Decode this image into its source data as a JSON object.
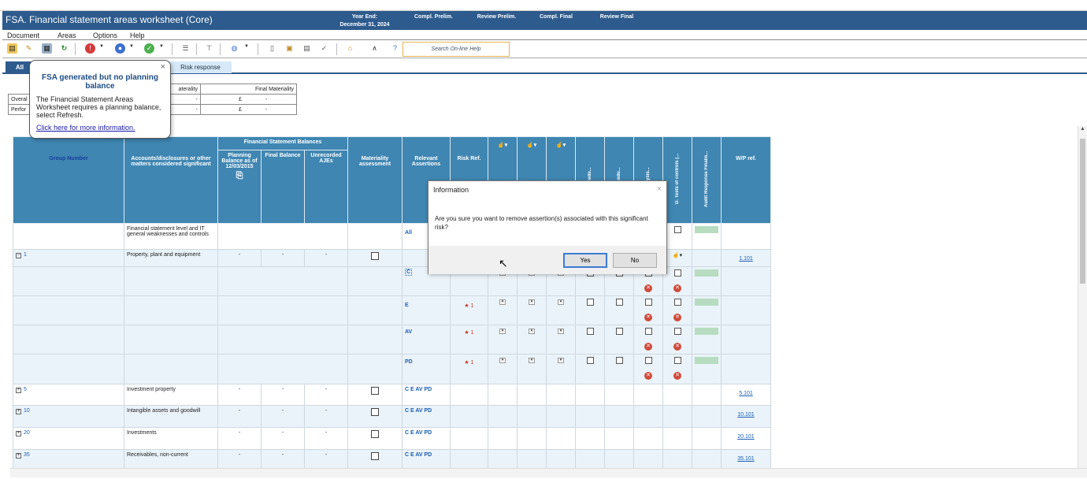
{
  "window": {
    "title": "FSA. Financial statement areas worksheet (Core)"
  },
  "header": {
    "year_end_label": "Year End:",
    "year_end_date": "December 31, 2024",
    "compl_prelim": "Compl. Prelim.",
    "review_prelim": "Review Prelim.",
    "compl_final": "Compl. Final",
    "review_final": "Review Final"
  },
  "menu": {
    "document": "Document",
    "areas": "Areas",
    "options": "Options",
    "help": "Help"
  },
  "toolbar": {
    "search_label": "Search On-line Help"
  },
  "tabs": {
    "all": "All",
    "risk_response": "Risk response"
  },
  "materiality": {
    "prelim_header": "aterality",
    "final_header": "Final Materiality",
    "overall_label": "Overal",
    "performance_label": "Perfor",
    "currency": "£",
    "dash": "-"
  },
  "tooltip": {
    "title": "FSA generated but no planning balance",
    "body": "The Financial Statement Areas Worksheet requires a planning balance, select Refresh.",
    "link": "Click here for more information.",
    "close": "×"
  },
  "grid": {
    "headers": {
      "group_number": "Group Number",
      "accounts": "Accounts/disclosures or other matters considered significant",
      "fs_balances": "Financial Statement Balances",
      "planning_balance": "Planning Balance as of 12/03/2015",
      "final_balance": "Final Balance",
      "unrecorded_ajes": "Unrecorded AJEs",
      "materiality_assessment": "Materiality assessment",
      "relevant_assertions": "Relevant Assertions",
      "risk_ref": "Risk Ref.",
      "proc_a": "procedu...",
      "proc_b": "procedu...",
      "analysis": "analysis...",
      "tests_controls": "D. Tests of controls (...",
      "audit_response": "Audit Response Finalis...",
      "wp_ref": "W/P ref."
    },
    "fs_row": {
      "text": "Financial statement level and IT general weaknesses and controls",
      "assertion": "All"
    },
    "groups": [
      {
        "num": "1",
        "name": "Property, plant and equipment",
        "pb": "-",
        "fb": "-",
        "ua": "-",
        "assertions": "",
        "wp": "1.101"
      },
      {
        "num": "5",
        "name": "Investment property",
        "pb": "-",
        "fb": "-",
        "ua": "-",
        "assertions": "C E AV PD",
        "wp": "5.101"
      },
      {
        "num": "10",
        "name": "Intangible assets and goodwill",
        "pb": "-",
        "fb": "-",
        "ua": "-",
        "assertions": "C E AV PD",
        "wp": "10.101"
      },
      {
        "num": "20",
        "name": "Investments",
        "pb": "-",
        "fb": "-",
        "ua": "-",
        "assertions": "C E AV PD",
        "wp": "20.101"
      },
      {
        "num": "35",
        "name": "Receivables, non-current",
        "pb": "-",
        "fb": "-",
        "ua": "-",
        "assertions": "C E AV PD",
        "wp": "35.101"
      }
    ],
    "sub_rows": [
      {
        "assertion": "C",
        "risk": "1"
      },
      {
        "assertion": "E",
        "risk": "1"
      },
      {
        "assertion": "AV",
        "risk": "1"
      },
      {
        "assertion": "PD",
        "risk": "1"
      }
    ]
  },
  "dialog": {
    "title": "Information",
    "message": "Are you sure you want to remove assertion(s) associated with this significant risk?",
    "yes": "Yes",
    "no": "No",
    "close": "×"
  }
}
